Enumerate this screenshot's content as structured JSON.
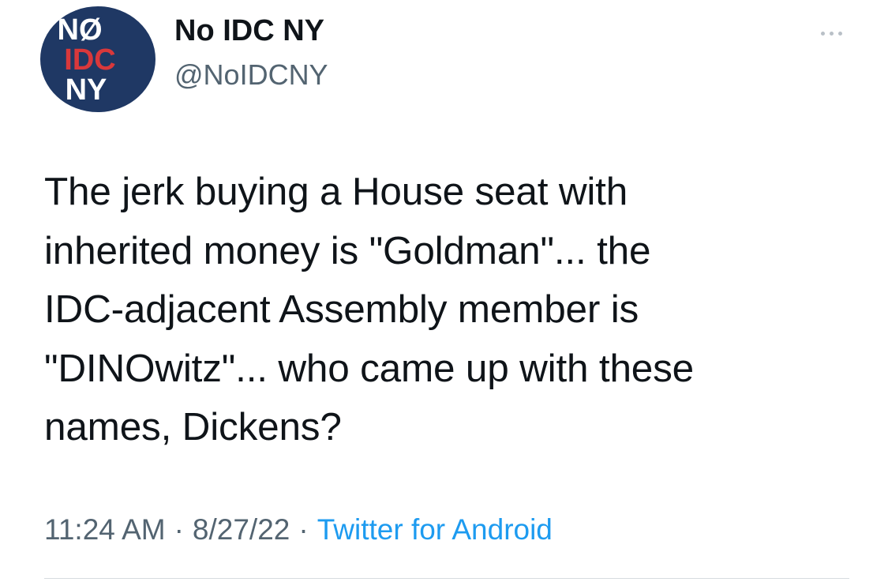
{
  "profile": {
    "avatar_lines": [
      "NØ",
      "IDC",
      "NY"
    ],
    "display_name": "No IDC NY",
    "handle": "@NoIDCNY"
  },
  "more_button_icon": "more-horizontal-icon",
  "tweet": {
    "text": "The jerk buying a House seat with\ninherited money is \"Goldman\"... the\nIDC-adjacent Assembly member is\n\"DINOwitz\"... who came up with these\nnames, Dickens?"
  },
  "meta": {
    "time": "11:24 AM",
    "date": "8/27/22",
    "separator": "·",
    "source": "Twitter for Android"
  },
  "colors": {
    "avatar_background": "#1f3864",
    "avatar_text_white": "#ffffff",
    "avatar_text_red": "#d9383b",
    "secondary_text": "#536471",
    "link": "#1d9bf0"
  }
}
